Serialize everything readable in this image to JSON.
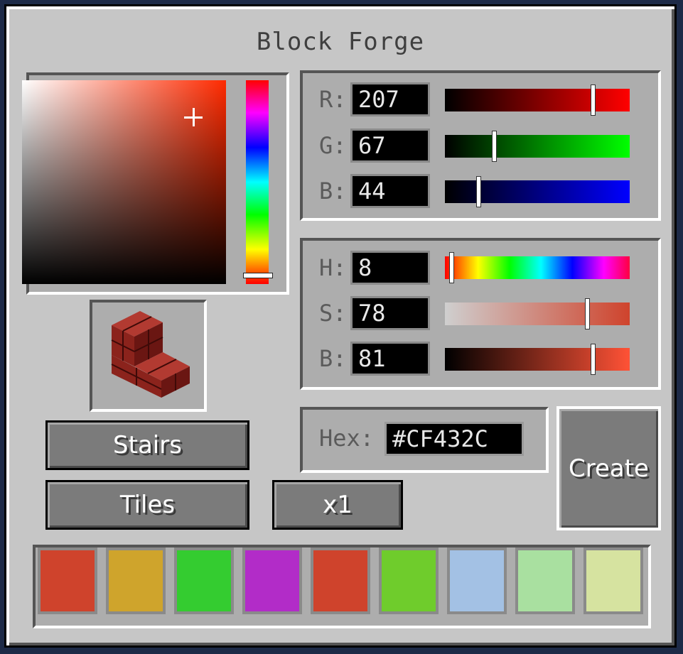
{
  "window": {
    "title": "Block Forge"
  },
  "rgb": {
    "r": {
      "label": "R:",
      "value": "207",
      "fraction": 0.8118
    },
    "g": {
      "label": "G:",
      "value": "67",
      "fraction": 0.2627
    },
    "b": {
      "label": "B:",
      "value": "44",
      "fraction": 0.1725
    }
  },
  "hsb": {
    "h": {
      "label": "H:",
      "value": "8",
      "fraction": 0.022
    },
    "s": {
      "label": "S:",
      "value": "78",
      "fraction": 0.78
    },
    "b": {
      "label": "B:",
      "value": "81",
      "fraction": 0.81
    }
  },
  "hex": {
    "label": "Hex:",
    "value": "#CF432C"
  },
  "buttons": {
    "shape": "Stairs",
    "texture": "Tiles",
    "quantity": "x1",
    "create": "Create"
  },
  "colors": {
    "current": "#cf432c",
    "swatches": [
      "#cf432c",
      "#cfa42c",
      "#34cc30",
      "#b22cc8",
      "#cf432c",
      "#6fcc2c",
      "#a3c1e4",
      "#a9e0a0",
      "#d6e3a0"
    ]
  },
  "icons": {
    "preview": "stairs-block-icon",
    "crosshair": "crosshair-icon"
  }
}
